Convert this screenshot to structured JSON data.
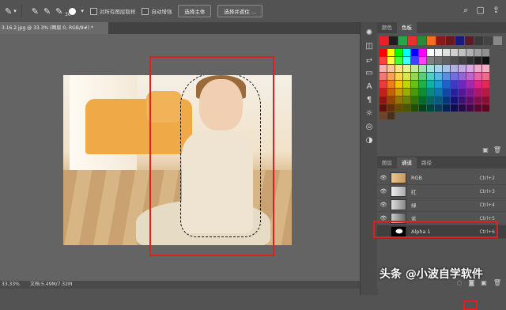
{
  "options_bar": {
    "brush_size": "30",
    "sample_all_layers_label": "对所有图层取样",
    "auto_enhance_label": "自动增强",
    "select_subject_label": "选择主体",
    "select_and_mask_label": "选择并遮住 ..."
  },
  "document": {
    "tab_title": "3.16.2.jpg @ 33.3% (图层 0, RGB/8#) *",
    "zoom": "33.33%",
    "doc_info": "文档:5.49M/7.32M"
  },
  "swatch_panel": {
    "tabs": [
      "颜色",
      "色板"
    ],
    "active_tab": "色板",
    "recent_colors": [
      "#e8202a",
      "#1f1f1f",
      "#2aa34a",
      "#e83030",
      "#2a8a3a",
      "#f07020",
      "#8a1a1a",
      "#6a1a1a",
      "#1a1a7a",
      "#5a1a2a",
      "#3a3a3a",
      "#444444",
      "#888888"
    ],
    "rows": [
      [
        "#ff0000",
        "#ffff00",
        "#00ff00",
        "#00ffff",
        "#0000ff",
        "#ff00ff",
        "#ffffff",
        "#f0f0f0",
        "#e0e0e0",
        "#d0d0d0",
        "#c0c0c0",
        "#b0b0b0",
        "#a0a0a0",
        "#909090"
      ],
      [
        "#ff4040",
        "#ffff40",
        "#40ff40",
        "#40ffff",
        "#4040ff",
        "#ff40ff",
        "#808080",
        "#707070",
        "#606060",
        "#505050",
        "#404040",
        "#303030",
        "#202020",
        "#101010"
      ],
      [
        "#f7b0b0",
        "#f9c79a",
        "#fbe58a",
        "#e9f28e",
        "#c2ea9a",
        "#a4e0b4",
        "#9fe2dc",
        "#a2d6f0",
        "#a8c0ec",
        "#b2aeea",
        "#c4a8e8",
        "#dca8e2",
        "#f0a8d0",
        "#f4aec0"
      ],
      [
        "#f07878",
        "#f4a35a",
        "#f8d648",
        "#d6e84c",
        "#96d45a",
        "#5ccc7a",
        "#52cec4",
        "#56b6e6",
        "#5c8edc",
        "#7070d8",
        "#9266d4",
        "#c264cc",
        "#e664a8",
        "#ec6c8a"
      ],
      [
        "#e83c3c",
        "#ee7e1c",
        "#f2c40a",
        "#bcd80c",
        "#6ac01a",
        "#1cb44a",
        "#10b2a6",
        "#169adc",
        "#1c62cc",
        "#3a3ac8",
        "#6a28c0",
        "#a826b4",
        "#d82686",
        "#e22a56"
      ],
      [
        "#c02020",
        "#c6600a",
        "#c89c04",
        "#96ae06",
        "#4c9810",
        "#0e8c36",
        "#088a80",
        "#0c78ae",
        "#1048a2",
        "#22229e",
        "#4e1896",
        "#82168c",
        "#aa166a",
        "#b41a42"
      ],
      [
        "#901414",
        "#944606",
        "#967402",
        "#708204",
        "#38720a",
        "#086826",
        "#046860",
        "#085a82",
        "#08347a",
        "#141476",
        "#3a1070",
        "#600e68",
        "#800e50",
        "#881030"
      ],
      [
        "#601010",
        "#623004",
        "#644e02",
        "#4a5602",
        "#244c06",
        "#044418",
        "#024440",
        "#063c56",
        "#042250",
        "#0c0c4e",
        "#260a4a",
        "#400846",
        "#540834",
        "#5a0a20"
      ],
      [
        "#6a4428",
        "#4a2e18"
      ]
    ]
  },
  "channels_panel": {
    "tabs": [
      "图层",
      "通道",
      "路径"
    ],
    "active_tab": "通道",
    "channels": [
      {
        "name": "RGB",
        "shortcut": "Ctrl+2",
        "visible": true
      },
      {
        "name": "红",
        "shortcut": "Ctrl+3",
        "visible": true
      },
      {
        "name": "绿",
        "shortcut": "Ctrl+4",
        "visible": true
      },
      {
        "name": "蓝",
        "shortcut": "Ctrl+5",
        "visible": true
      },
      {
        "name": "Alpha 1",
        "shortcut": "Ctrl+6",
        "visible": false
      }
    ]
  },
  "watermark": "头条 @小波自学软件"
}
